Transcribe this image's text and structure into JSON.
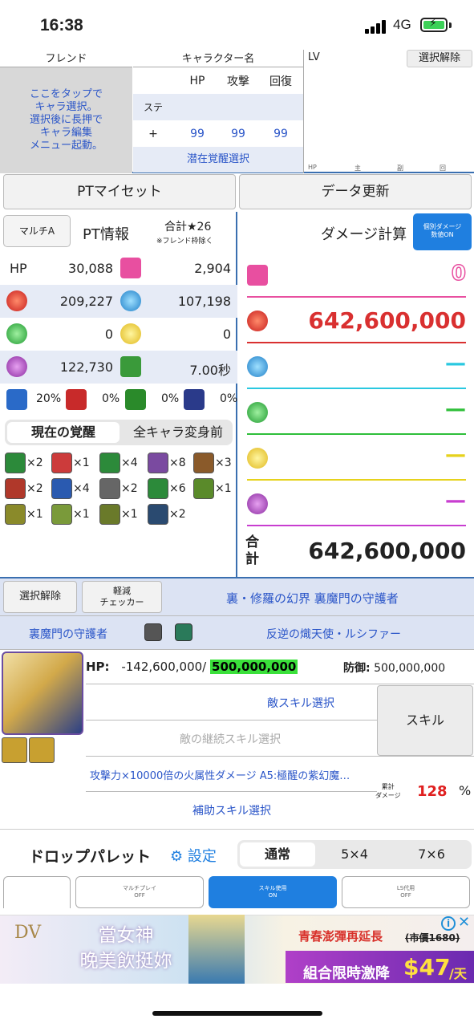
{
  "status": {
    "time": "16:38",
    "network": "4G"
  },
  "friend": {
    "header": "フレンド",
    "placeholder": "ここをタップで\nキャラ選択。\n選択後に長押で\nキャラ編集\nメニュー起動。"
  },
  "character": {
    "header": "キャラクター名",
    "col_hp": "HP",
    "col_atk": "攻撃",
    "col_rcv": "回復",
    "row_stat": "ステ",
    "row_plus": "+",
    "plus_hp": "99",
    "plus_atk": "99",
    "plus_rcv": "99",
    "latent": "潜在覚醒選択"
  },
  "lv": {
    "label": "LV",
    "deselect": "選択解除",
    "sub": [
      "HP",
      "主",
      "副",
      "回"
    ]
  },
  "buttons": {
    "preset": "PTマイセット",
    "refresh": "データ更新"
  },
  "pt": {
    "multi": "マルチA",
    "title": "PT情報",
    "total": "合計★26",
    "total_note": "※フレンド枠除く",
    "hp_label": "HP",
    "hp": "30,088",
    "heart": "2,904",
    "fire": "209,227",
    "water": "107,198",
    "wood": "0",
    "light": "0",
    "dark": "122,730",
    "time": "7.00秒",
    "res": [
      "20%",
      "0%",
      "0%",
      "0%"
    ]
  },
  "awaken": {
    "tab_current": "現在の覚醒",
    "tab_all": "全キャラ変身前",
    "items": [
      {
        "icon": "enhanced-combo-icon",
        "count": "×2",
        "color": "#2c8a3a"
      },
      {
        "icon": "skill-boost-icon",
        "count": "×1",
        "color": "#cc3b3b"
      },
      {
        "icon": "time-extend-icon",
        "count": "×4",
        "color": "#2c8a3a"
      },
      {
        "icon": "seven-combo-icon",
        "count": "×8",
        "color": "#7a4aa0"
      },
      {
        "icon": "ten-combo-icon",
        "count": "×3",
        "color": "#8a5a2a"
      },
      {
        "icon": "cross-icon",
        "count": "×2",
        "color": "#b0382a"
      },
      {
        "icon": "multi-color-icon",
        "count": "×4",
        "color": "#2a5ab0"
      },
      {
        "icon": "guard-break-icon",
        "count": "×2",
        "color": "#666"
      },
      {
        "icon": "killer-icon",
        "count": "×6",
        "color": "#2c8a3a"
      },
      {
        "icon": "devil-killer-icon",
        "count": "×1",
        "color": "#5a8a2a"
      },
      {
        "icon": "dragon-killer-icon",
        "count": "×1",
        "color": "#8a8a2a"
      },
      {
        "icon": "god-killer-icon",
        "count": "×1",
        "color": "#7a9a3a"
      },
      {
        "icon": "machine-killer-icon",
        "count": "×1",
        "color": "#6a7a2a"
      },
      {
        "icon": "orb-skyfall-icon",
        "count": "×2",
        "color": "#2a4a70"
      }
    ]
  },
  "damage": {
    "title": "ダメージ計算",
    "toggle": "個別ダメージ\n数値ON",
    "heart": "0",
    "fire": "642,600,000",
    "water": "—",
    "wood": "—",
    "light": "—",
    "dark": "—",
    "total_label": "合\n計",
    "total": "642,600,000"
  },
  "enemy": {
    "deselect": "選択解除",
    "checker": "軽減\nチェッカー",
    "dungeon": "裏・修羅の幻界 裏魔門の守護者",
    "floor": "裏魔門の守護者",
    "boss": "反逆の熾天使・ルシファー",
    "hp_label": "HP:",
    "hp_current": "-142,600,000/",
    "hp_max": "500,000,000",
    "def_label": "防御:",
    "def": "500,000,000",
    "skill_select": "敵スキル選択",
    "cont_skill": "敵の継続スキル選択",
    "skill_btn": "スキル",
    "attack": "攻撃力×10000倍の火属性ダメージ A5:極醒の紫幻魔…",
    "cumulative": "累計\nダメージ",
    "percent": "128",
    "percent_unit": "%",
    "support": "補助スキル選択"
  },
  "palette": {
    "title": "ドロップパレット",
    "settings": "設定",
    "tabs": [
      "通常",
      "5×4",
      "7×6"
    ],
    "multi": "マルチプレイ\nOFF",
    "skill": "スキル使用\nON",
    "ls": "LS代用\nOFF"
  },
  "ad": {
    "brand": "DV",
    "left_text": "當女神\n晚美飲挺妳",
    "right_top": "青春澎彈再延長",
    "price_old": "(市價1680)",
    "right_bottom": "組合限時激降",
    "price": "$47",
    "price_unit": "/天"
  },
  "colors": {
    "accent": "#1f7fe0",
    "fire": "#d93030",
    "water": "#2aa8d8",
    "wood": "#2fbf3a",
    "light": "#e6d21c",
    "dark": "#b33ec6",
    "heart": "#e84fa0"
  }
}
